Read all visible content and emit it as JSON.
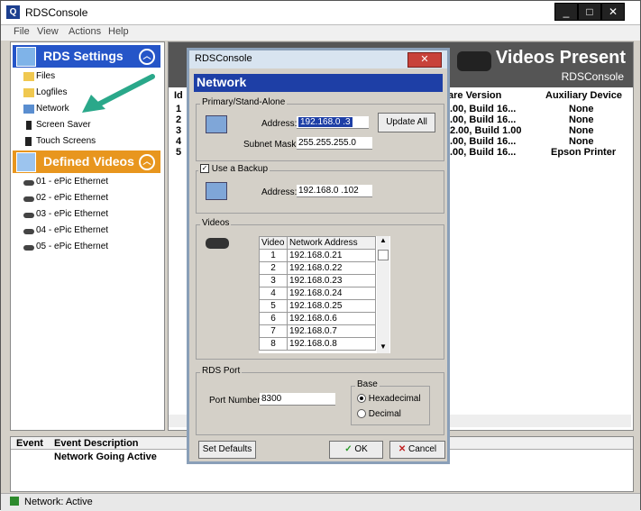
{
  "window": {
    "title": "RDSConsole",
    "controls": [
      "_",
      "□",
      "✕"
    ]
  },
  "menu": [
    "File",
    "View",
    "Actions",
    "Help"
  ],
  "left": {
    "settings_header": "RDS Settings",
    "settings_items": [
      "Files",
      "Logfiles",
      "Network",
      "Screen Saver",
      "Touch Screens"
    ],
    "videos_header": "Defined Videos",
    "video_items": [
      "01 - ePic Ethernet",
      "02 - ePic Ethernet",
      "03 - ePic Ethernet",
      "04 - ePic Ethernet",
      "05 - ePic Ethernet"
    ]
  },
  "banner": {
    "title": "Videos Present",
    "subtitle": "RDSConsole"
  },
  "right_table": {
    "headers": [
      "Id",
      "are Version",
      "Auxiliary Device"
    ],
    "ids": [
      "1",
      "2",
      "3",
      "4",
      "5"
    ],
    "versions": [
      ".00, Build 16...",
      ".00, Build 16...",
      "2.00, Build 1.00",
      ".00, Build 16...",
      ".00, Build 16..."
    ],
    "aux": [
      "None",
      "None",
      "None",
      "None",
      "Epson Printer"
    ]
  },
  "events": {
    "col_event": "Event",
    "col_desc": "Event Description",
    "row1_desc": "Network Going Active"
  },
  "status": {
    "text": "Network: Active"
  },
  "dialog": {
    "title": "RDSConsole",
    "close": "✕",
    "heading": "Network",
    "primary_group": "Primary/Stand-Alone",
    "address_label": "Address:",
    "address_value": "192.168.0 .3",
    "update_all": "Update All",
    "subnet_label": "Subnet Mask:",
    "subnet_value": "255.255.255.0",
    "backup_label": "Use a Backup",
    "backup_checked": true,
    "backup_address_label": "Address:",
    "backup_address_value": "192.168.0 .102",
    "videos_group": "Videos",
    "video_col": "Video",
    "addr_col": "Network Address",
    "videos": [
      {
        "n": "1",
        "addr": "192.168.0.21"
      },
      {
        "n": "2",
        "addr": "192.168.0.22"
      },
      {
        "n": "3",
        "addr": "192.168.0.23"
      },
      {
        "n": "4",
        "addr": "192.168.0.24"
      },
      {
        "n": "5",
        "addr": "192.168.0.25"
      },
      {
        "n": "6",
        "addr": "192.168.0.6"
      },
      {
        "n": "7",
        "addr": "192.168.0.7"
      },
      {
        "n": "8",
        "addr": "192.168.0.8"
      }
    ],
    "rds_group": "RDS Port",
    "port_label": "Port Number:",
    "port_value": "8300",
    "base_group": "Base",
    "base_options": [
      "Hexadecimal",
      "Decimal"
    ],
    "base_selected": "Hexadecimal",
    "set_defaults": "Set Defaults",
    "ok": "OK",
    "cancel": "Cancel"
  },
  "colors": {
    "header_blue": "#1e3fa6",
    "videos_orange": "#e8961e",
    "arrow": "#2aa88a"
  }
}
